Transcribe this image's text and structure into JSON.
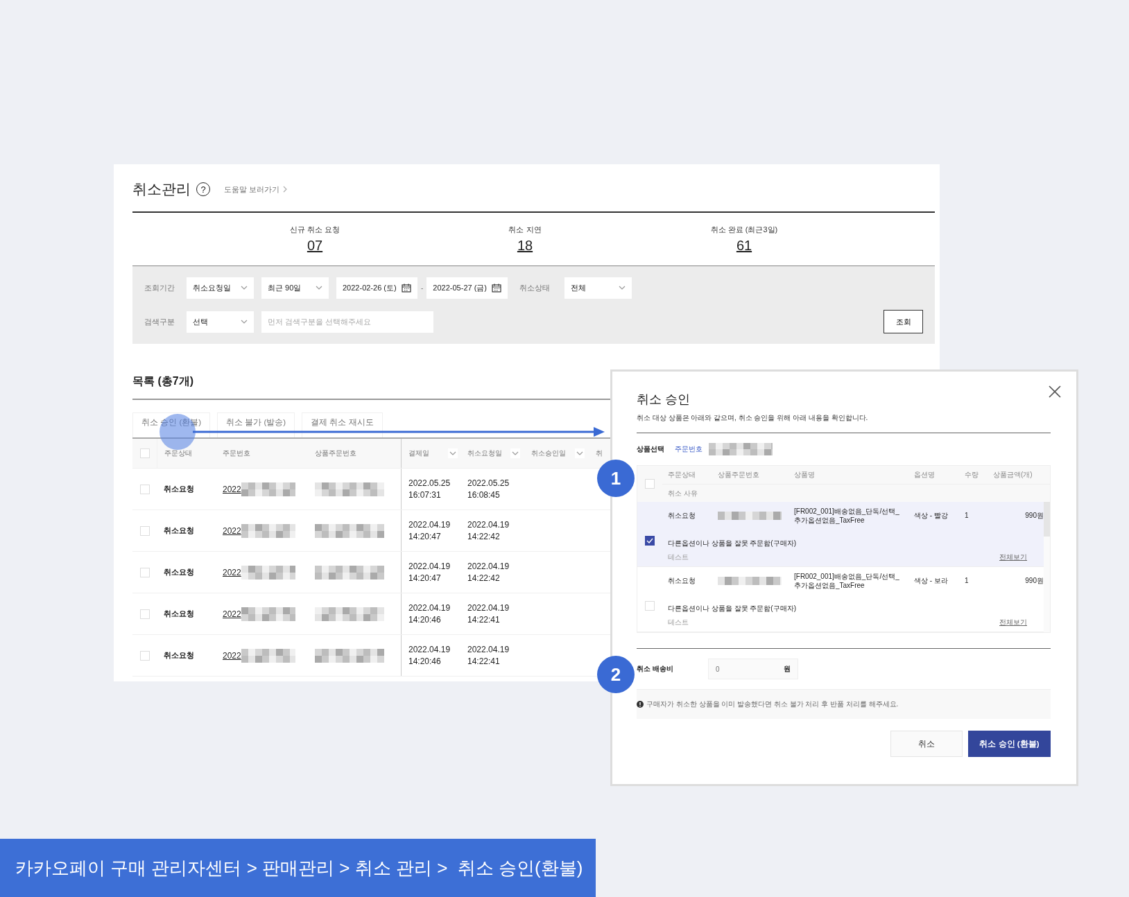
{
  "page": {
    "title": "취소관리",
    "help_glyph": "?",
    "help_link": "도움말 보러가기"
  },
  "summary": [
    {
      "label": "신규 취소 요청",
      "count": "07"
    },
    {
      "label": "취소 지연",
      "count": "18"
    },
    {
      "label": "취소 완료 (최근3일)",
      "count": "61"
    }
  ],
  "filters": {
    "rows": [
      [
        {
          "kind": "label",
          "text": "조회기간"
        },
        {
          "kind": "select",
          "value": "취소요청일"
        },
        {
          "kind": "select",
          "value": "최근 90일"
        },
        {
          "kind": "date",
          "value": "2022-02-26 (토)"
        },
        {
          "kind": "sep",
          "text": "-"
        },
        {
          "kind": "date",
          "value": "2022-05-27 (금)"
        },
        {
          "kind": "label",
          "text": "취소상태"
        },
        {
          "kind": "select",
          "value": "전체"
        }
      ],
      [
        {
          "kind": "label",
          "text": "검색구분"
        },
        {
          "kind": "select",
          "value": "선택"
        },
        {
          "kind": "input",
          "placeholder": "먼저 검색구분을 선택해주세요"
        }
      ]
    ],
    "search_button": "조회"
  },
  "list": {
    "title": "목록 (총7개)",
    "actions": [
      "취소 승인 (환불)",
      "취소 불가 (발송)",
      "결제 취소 재시도"
    ],
    "header_checked": false,
    "columns": [
      {
        "label": "주문상태",
        "sortable": false
      },
      {
        "label": "주문번호",
        "sortable": false
      },
      {
        "label": "상품주문번호",
        "sortable": false
      },
      {
        "label": "결제일",
        "sortable": true
      },
      {
        "label": "취소요청일",
        "sortable": true
      },
      {
        "label": "취소승인일",
        "sortable": true
      },
      {
        "label": "취",
        "sortable": false
      }
    ],
    "rows": [
      {
        "checked": false,
        "status": "취소요청",
        "order_no": "2022",
        "paid": "2022.05.25\n16:07:31",
        "requested": "2022.05.25\n16:08:45"
      },
      {
        "checked": false,
        "status": "취소요청",
        "order_no": "2022",
        "paid": "2022.04.19\n14:20:47",
        "requested": "2022.04.19\n14:22:42"
      },
      {
        "checked": false,
        "status": "취소요청",
        "order_no": "2022",
        "paid": "2022.04.19\n14:20:47",
        "requested": "2022.04.19\n14:22:42"
      },
      {
        "checked": false,
        "status": "취소요청",
        "order_no": "2022",
        "paid": "2022.04.19\n14:20:46",
        "requested": "2022.04.19\n14:22:41"
      },
      {
        "checked": false,
        "status": "취소요청",
        "order_no": "2022",
        "paid": "2022.04.19\n14:20:46",
        "requested": "2022.04.19\n14:22:41"
      }
    ]
  },
  "modal": {
    "title": "취소 승인",
    "description": "취소 대상 상품은 아래와 같으며, 취소 승인을 위해 아래 내용을 확인합니다.",
    "select_label": "상품선택",
    "order_link": "주문번호",
    "header_checked": false,
    "columns": [
      "주문상태",
      "상품주문번호",
      "상품명",
      "옵션명",
      "수량",
      "상품금액(개)"
    ],
    "reason_header": "취소 사유",
    "items": [
      {
        "checked": true,
        "status": "취소요청",
        "name": "[FR002_001]배송없음_단독/선택_\n추가옵션없음_TaxFree",
        "option": "색상 - 빨강",
        "qty": "1",
        "price": "990원",
        "reason": "다른옵션이나 상품을 잘못 주문함(구매자)",
        "memo": "테스트",
        "more": "전체보기"
      },
      {
        "checked": false,
        "status": "취소요청",
        "name": "[FR002_001]배송없음_단독/선택_\n추가옵션없음_TaxFree",
        "option": "색상 - 보라",
        "qty": "1",
        "price": "990원",
        "reason": "다른옵션이나 상품을 잘못 주문함(구매자)",
        "memo": "테스트",
        "more": "전체보기"
      }
    ],
    "fee_label": "취소 배송비",
    "fee_value": "0",
    "fee_unit": "원",
    "notice": "구매자가 취소한 상품을 이미 발송했다면 취소 불가 처리 후 반품 처리를 해주세요.",
    "buttons": [
      {
        "label": "취소",
        "kind": "secondary"
      },
      {
        "label": "취소 승인 (환불)",
        "kind": "primary"
      }
    ]
  },
  "callouts": [
    {
      "label": "1"
    },
    {
      "label": "2"
    }
  ],
  "breadcrumb": "카카오페이 구매 관리자센터 > 판매관리 > 취소 관리 >  취소 승인(환불)"
}
